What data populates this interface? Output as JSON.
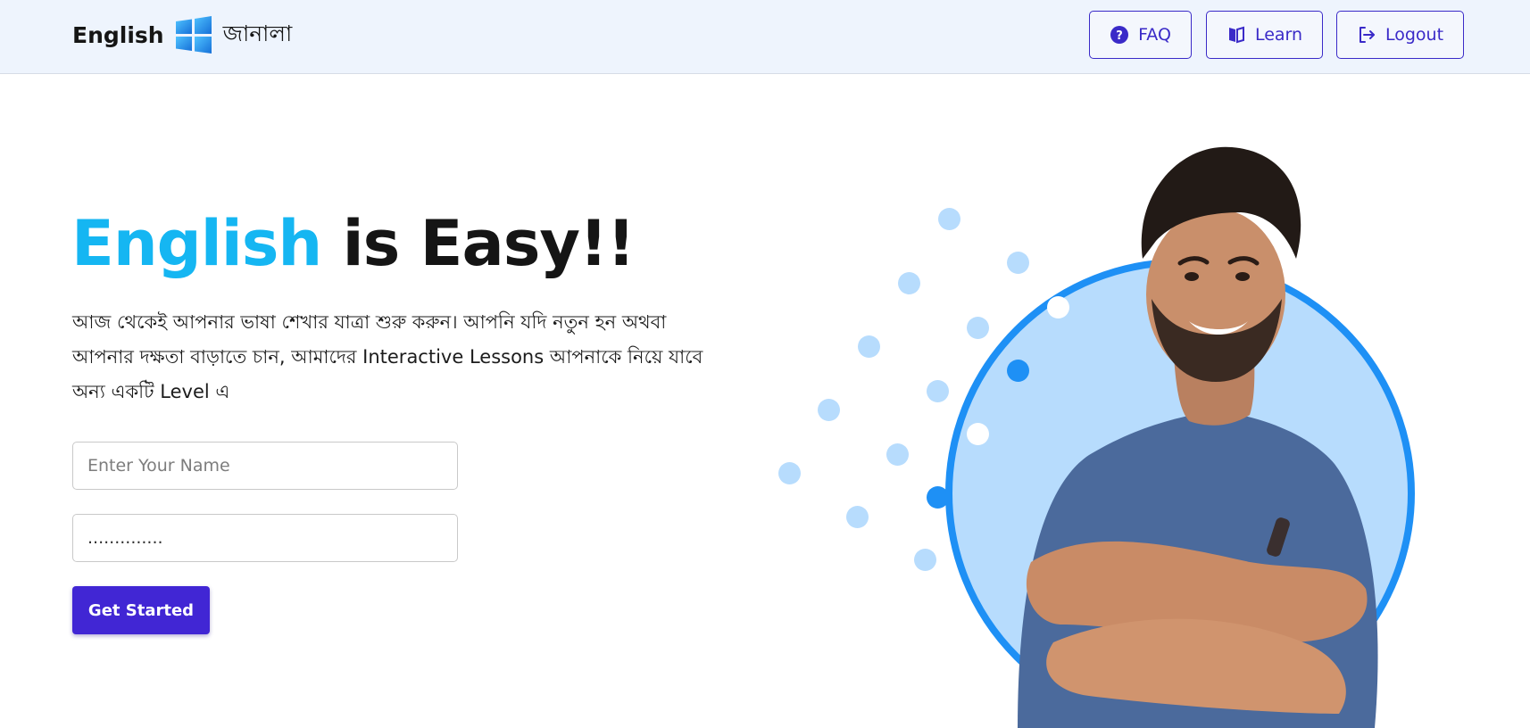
{
  "header": {
    "brand_en": "English",
    "brand_bn": "জানালা",
    "nav": {
      "faq": "FAQ",
      "learn": "Learn",
      "logout": "Logout"
    }
  },
  "hero": {
    "title_accent": "English",
    "title_rest": " is Easy!!",
    "description": "আজ থেকেই আপনার ভাষা শেখার যাত্রা শুরু করুন। আপনি যদি নতুন হন অথবা আপনার দক্ষতা বাড়াতে চান, আমাদের Interactive Lessons আপনাকে নিয়ে যাবে অন্য একটি Level এ"
  },
  "form": {
    "name_placeholder": "Enter Your Name",
    "password_value": "..............",
    "submit_label": "Get Started"
  },
  "colors": {
    "accent": "#15b6f2",
    "primary": "#4126d4",
    "nav_border": "#3a2ac8",
    "header_bg": "#eef4fd",
    "circle_ring": "#1e90f5",
    "circle_fill": "#b7dcfd"
  },
  "icons": {
    "faq": "question-circle-icon",
    "learn": "book-icon",
    "logout": "logout-icon",
    "brand": "windows-logo-icon"
  }
}
